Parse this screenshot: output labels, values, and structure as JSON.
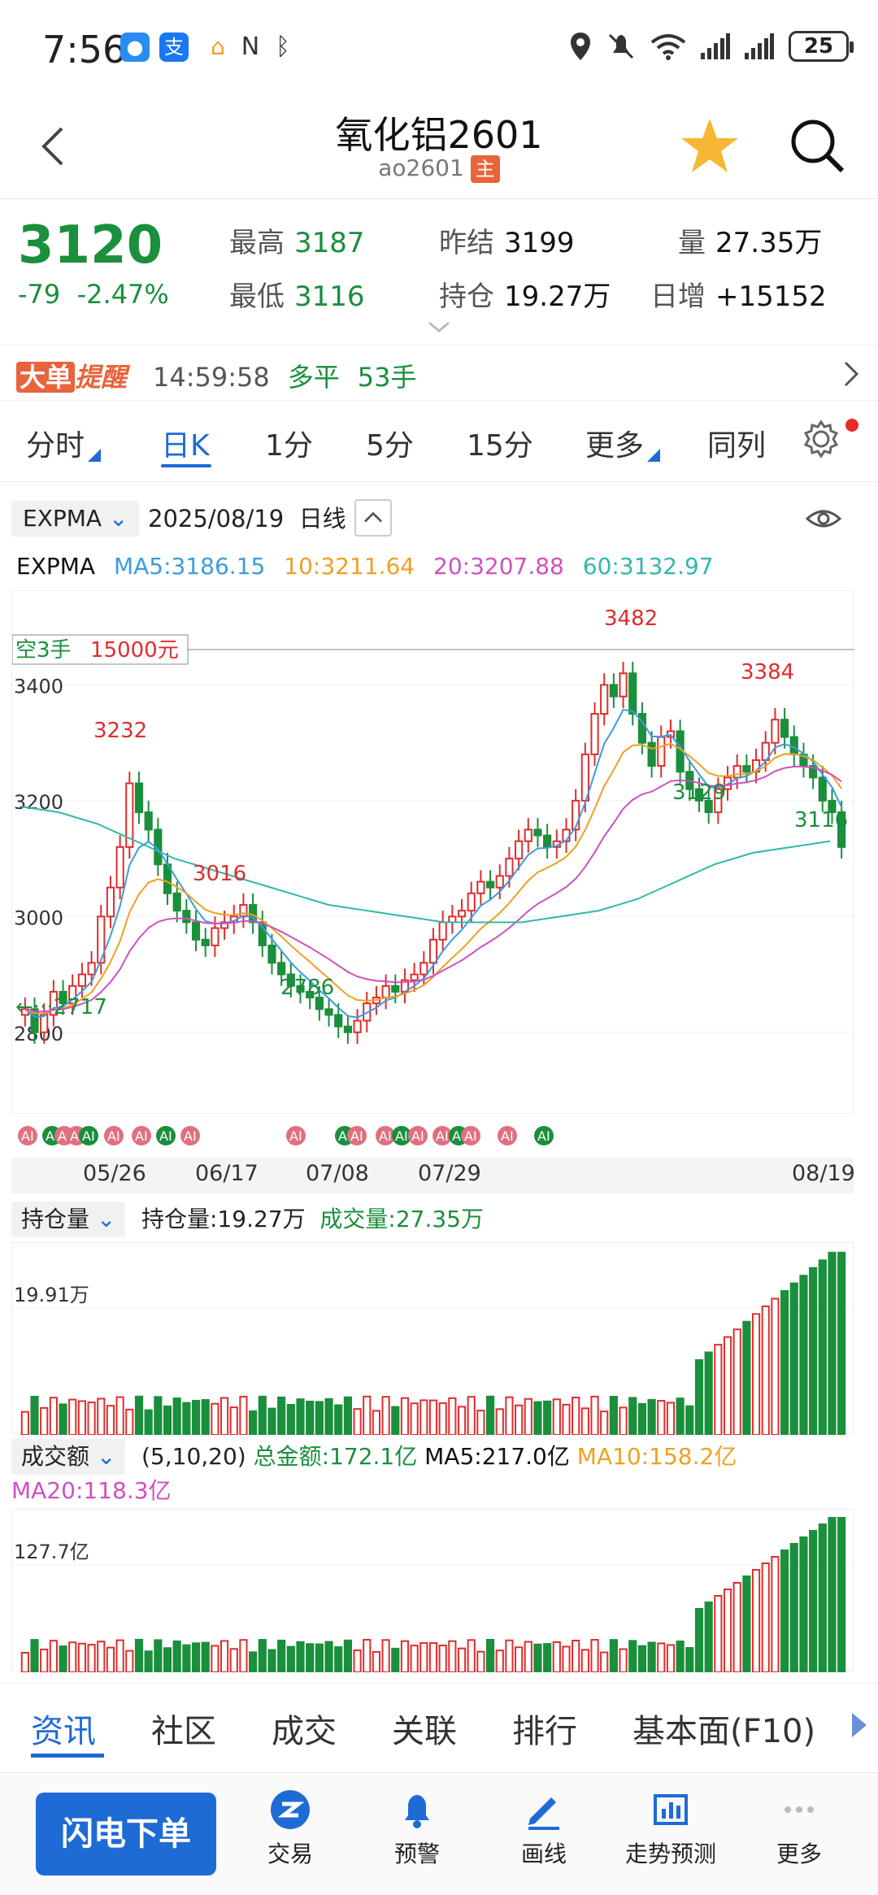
{
  "status": {
    "time": "7:56",
    "battery": "25",
    "app_icons": [
      "message-icon",
      "alipay-icon",
      "home-icon",
      "nfc-icon",
      "bluetooth-icon"
    ]
  },
  "header": {
    "title": "氧化铝2601",
    "code": "ao2601",
    "main_tag": "主"
  },
  "quote": {
    "price": "3120",
    "change": "-79",
    "change_pct": "-2.47%",
    "high_label": "最高",
    "high": "3187",
    "low_label": "最低",
    "low": "3116",
    "prev_settle_label": "昨结",
    "prev_settle": "3199",
    "open_interest_label": "持仓",
    "open_interest": "19.27万",
    "volume_label": "量",
    "volume": "27.35万",
    "daily_inc_label": "日增",
    "daily_inc": "+15152"
  },
  "alert": {
    "logo_big": "大单",
    "logo_remind": "提醒",
    "time": "14:59:58",
    "action": "多平",
    "lots": "53手"
  },
  "period_tabs": [
    "分时",
    "日K",
    "1分",
    "5分",
    "15分",
    "更多",
    "同列"
  ],
  "period_active": 1,
  "indicator": {
    "name": "EXPMA",
    "date": "2025/08/19",
    "period": "日线"
  },
  "ma": {
    "label": "EXPMA",
    "ma5": "MA5:3186.15",
    "ma10": "10:3211.64",
    "ma20": "20:3207.88",
    "ma60": "60:3132.97"
  },
  "colors": {
    "up": "#e02c2c",
    "down": "#1a8f3c",
    "ma5": "#3c9be0",
    "ma10": "#f0a020",
    "ma20": "#d050c0",
    "ma60": "#30b8a8",
    "accent": "#1f6bd6"
  },
  "chart_data": {
    "type": "candlestick",
    "y_ticks": [
      "3400",
      "3200",
      "3000",
      "2800"
    ],
    "y_range": [
      2700,
      3520
    ],
    "x_ticks": [
      "05/26",
      "06/17",
      "07/08",
      "07/29",
      "08/19"
    ],
    "annotations": {
      "high": "3482",
      "peak2": "3384",
      "peak_may": "3232",
      "peak_june": "3016",
      "low_june": "2786",
      "low_july": "3129",
      "last_low": "3116",
      "first_low": "←···2717"
    },
    "short_position": "空3手",
    "short_price": "15000元",
    "closes": [
      2840,
      2800,
      2830,
      2870,
      2850,
      2880,
      2900,
      2920,
      3000,
      3050,
      3120,
      3230,
      3180,
      3150,
      3090,
      3040,
      3010,
      2990,
      2960,
      2950,
      2980,
      2990,
      3000,
      3020,
      2990,
      2950,
      2920,
      2900,
      2880,
      2870,
      2860,
      2840,
      2830,
      2810,
      2800,
      2820,
      2850,
      2860,
      2880,
      2870,
      2890,
      2900,
      2920,
      2960,
      2990,
      3000,
      3010,
      3040,
      3060,
      3050,
      3070,
      3100,
      3130,
      3150,
      3140,
      3120,
      3130,
      3150,
      3200,
      3280,
      3350,
      3400,
      3380,
      3420,
      3350,
      3300,
      3260,
      3310,
      3320,
      3250,
      3220,
      3200,
      3180,
      3220,
      3240,
      3260,
      3250,
      3270,
      3300,
      3340,
      3310,
      3280,
      3260,
      3240,
      3200,
      3180,
      3120
    ],
    "ma60_approx": [
      3190,
      3180,
      3160,
      3130,
      3100,
      3080,
      3060,
      3040,
      3020,
      3010,
      3000,
      2990,
      2990,
      2990,
      3000,
      3010,
      3030,
      3060,
      3090,
      3110,
      3120,
      3130
    ]
  },
  "ai_badge": "AI",
  "oi_panel": {
    "select": "持仓量",
    "oi_text": "持仓量:19.27万",
    "vol_text": "成交量:27.35万",
    "y_tick": "19.91万"
  },
  "amount_panel": {
    "select": "成交额",
    "params": "(5,10,20)",
    "total": "总金额:172.1亿",
    "ma5": "MA5:217.0亿",
    "ma10": "MA10:158.2亿",
    "ma20": "MA20:118.3亿",
    "y_tick": "127.7亿"
  },
  "info_tabs": [
    "资讯",
    "社区",
    "成交",
    "关联",
    "排行",
    "基本面(F10)"
  ],
  "bottom_nav": {
    "flash_order": "闪电下单",
    "items": [
      "交易",
      "预警",
      "画线",
      "走势预测",
      "更多"
    ]
  }
}
